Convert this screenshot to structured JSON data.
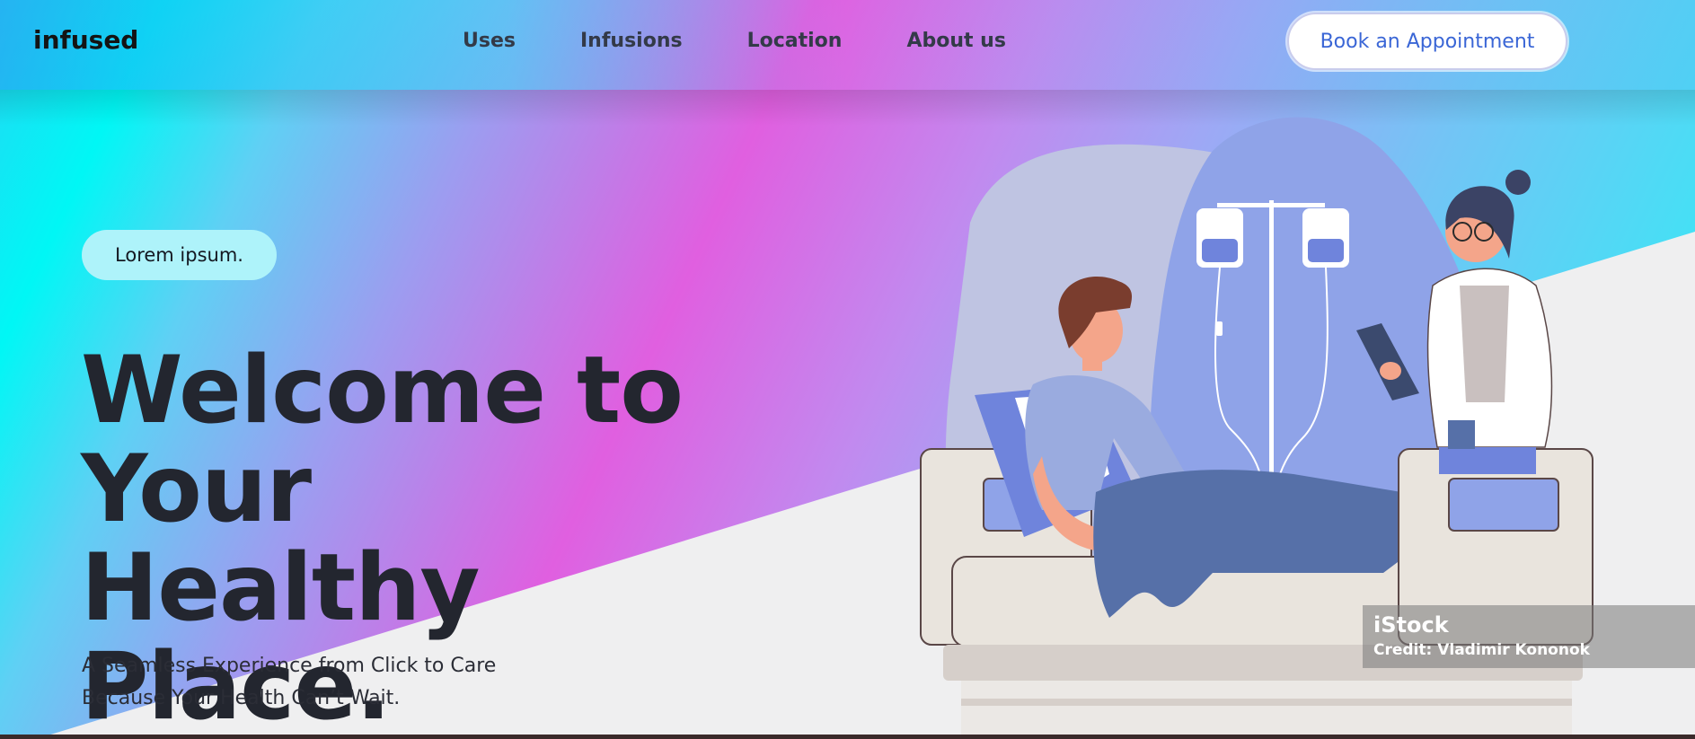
{
  "brand": "infused",
  "nav": {
    "items": [
      {
        "label": "Uses"
      },
      {
        "label": "Infusions"
      },
      {
        "label": "Location"
      },
      {
        "label": "About us"
      }
    ],
    "cta_label": "Book an Appointment"
  },
  "hero": {
    "badge": "Lorem ipsum.",
    "title_lines": [
      "Welcome to",
      "Your Healthy",
      "Place."
    ],
    "subtitle": "A Seamless Experience from Click to Care Because Your Health Can’t Wait."
  },
  "watermark": {
    "brand": "iStock",
    "credit": "Credit: Vladimir Kononok"
  },
  "colors": {
    "cta_text": "#3a66d6",
    "badge_bg": "#aef3fa",
    "title": "#23262f"
  }
}
